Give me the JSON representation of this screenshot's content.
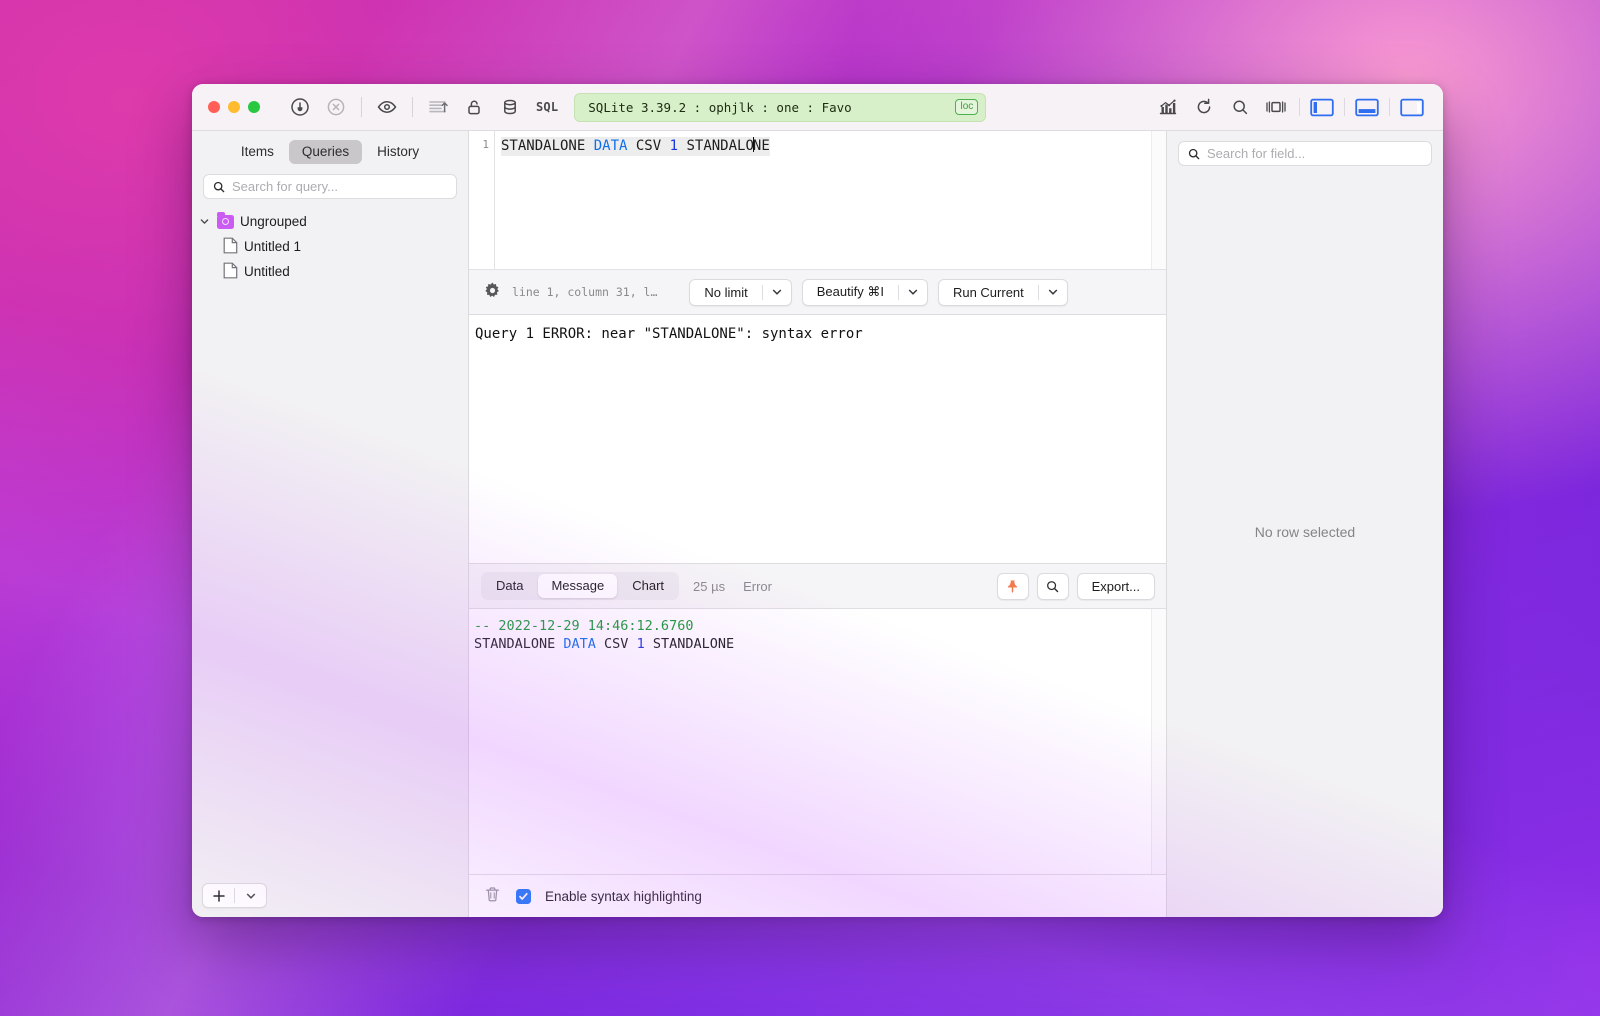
{
  "window": {
    "traffic_lights": [
      "close",
      "minimize",
      "zoom"
    ],
    "connection": {
      "label": "SQLite 3.39.2 : ophjlk : one : Favo",
      "badge": "loc",
      "badge_color": "#4caf50",
      "pill_color": "#d8f0c9"
    },
    "sql_label": "SQL",
    "toolbar_icons": [
      "plug-icon",
      "disconnect-icon",
      "eye-icon",
      "indent-icon",
      "unlock-icon",
      "database-icon",
      "chart-stats-icon",
      "refresh-icon",
      "search-icon",
      "center-panel-icon",
      "left-panel-toggle-icon",
      "bottom-panel-toggle-icon",
      "right-panel-toggle-icon"
    ]
  },
  "sidebar": {
    "tabs": [
      {
        "label": "Items",
        "active": false
      },
      {
        "label": "Queries",
        "active": true
      },
      {
        "label": "History",
        "active": false
      }
    ],
    "search": {
      "placeholder": "Search for query...",
      "value": ""
    },
    "tree": [
      {
        "label": "Ungrouped",
        "type": "folder",
        "expanded": true,
        "icon": "folder-gear-icon"
      },
      {
        "label": "Untitled 1",
        "type": "file",
        "icon": "document-icon"
      },
      {
        "label": "Untitled",
        "type": "file",
        "icon": "document-icon"
      }
    ],
    "footer": {
      "add_label": "+",
      "menu_icon": "chevron-down-icon"
    }
  },
  "editor": {
    "line_number": "1",
    "code": {
      "t1": "STANDALONE ",
      "kw": "DATA",
      "t2": " CSV ",
      "num": "1",
      "t3": " STANDALO",
      "t4": "NE"
    },
    "plain_text": "STANDALONE DATA CSV 1 STANDALONE"
  },
  "statusbar": {
    "gear_icon": "gear-icon",
    "position": "line 1, column 31, l…",
    "limit": {
      "label": "No limit"
    },
    "beautify": {
      "label": "Beautify ⌘I"
    },
    "run": {
      "label": "Run Current"
    }
  },
  "result": {
    "error_text": "Query 1 ERROR: near \"STANDALONE\": syntax error"
  },
  "result_toolbar": {
    "tabs": [
      {
        "label": "Data",
        "active": false
      },
      {
        "label": "Message",
        "active": true
      },
      {
        "label": "Chart",
        "active": false
      }
    ],
    "duration": "25 µs",
    "error_label": "Error",
    "pin_icon": "pin-icon",
    "search_icon": "search-icon",
    "export_label": "Export..."
  },
  "message_pane": {
    "timestamp_line": "-- 2022-12-29 14:46:12.6760",
    "query_line": {
      "t1": "STANDALONE ",
      "kw": "DATA",
      "t2": " CSV ",
      "num": "1",
      "t3": " STANDALONE"
    }
  },
  "bottombar": {
    "trash_icon": "trash-icon",
    "checkbox_checked": true,
    "checkbox_label": "Enable syntax highlighting"
  },
  "right_panel": {
    "search": {
      "placeholder": "Search for field...",
      "value": ""
    },
    "empty_state": "No row selected"
  },
  "colors": {
    "accent_blue": "#2079f6",
    "keyword_blue": "#0f6fe8",
    "number_blue": "#1b36e0",
    "comment_green": "#1a9b35",
    "pin_orange": "#f07a52"
  }
}
